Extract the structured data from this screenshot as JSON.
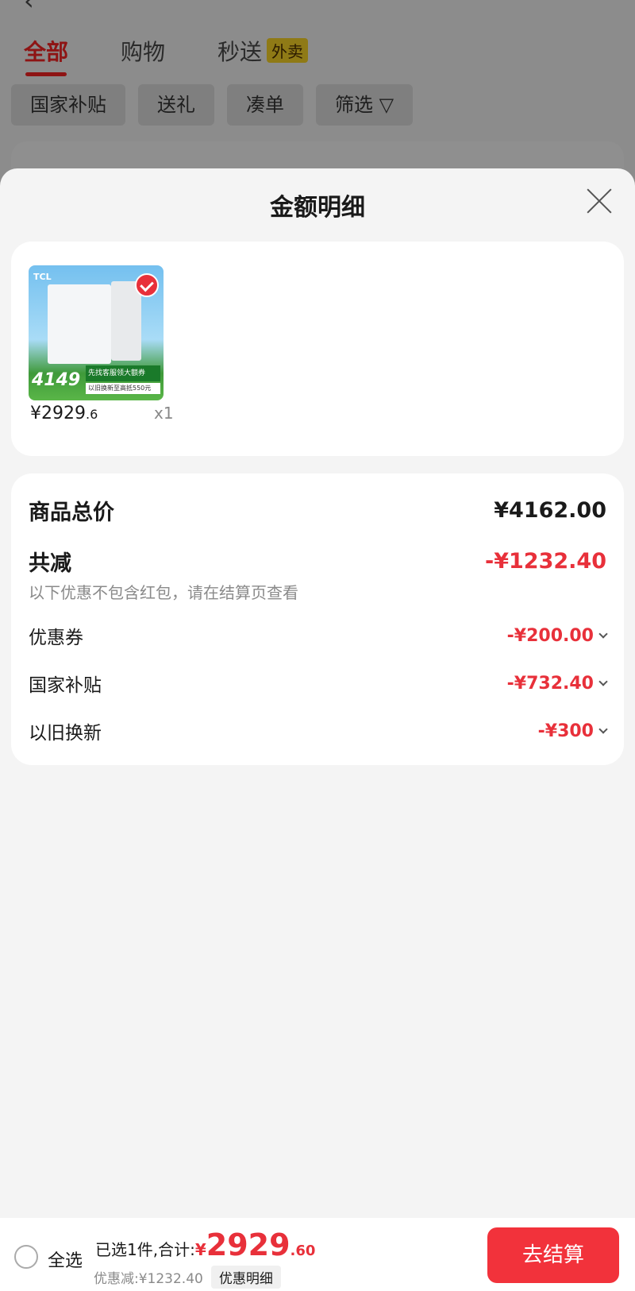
{
  "background": {
    "tabs": [
      {
        "label": "全部",
        "active": true
      },
      {
        "label": "购物",
        "active": false
      },
      {
        "label": "秒送",
        "active": false,
        "badge": "外卖"
      }
    ],
    "chips": [
      "国家补贴",
      "送礼",
      "凑单",
      "筛选 ▽"
    ]
  },
  "sheet": {
    "title": "金额明细",
    "product": {
      "image_brand": "TCL",
      "image_price": "4149",
      "image_banner": "先找客服领大额券",
      "image_banner2": "以旧换新至高抵550元",
      "price_int": "¥2929",
      "price_dec": ".6",
      "quantity": "x1"
    },
    "summary": {
      "total_label": "商品总价",
      "total_value": "¥4162.00",
      "reduce_label": "共减",
      "reduce_value": "-¥1232.40",
      "note": "以下优惠不包含红包，请在结算页查看",
      "items": [
        {
          "label": "优惠券",
          "value": "-¥200.00"
        },
        {
          "label": "国家补贴",
          "value": "-¥732.40"
        },
        {
          "label": "以旧换新",
          "value": "-¥300"
        }
      ]
    }
  },
  "bottom": {
    "select_all": "全选",
    "total_prefix": "已选1件,合计:",
    "yen": "¥",
    "total_int": "2929",
    "total_dec": ".60",
    "saving": "优惠减:¥1232.40",
    "detail_tag": "优惠明细",
    "checkout": "去结算"
  },
  "colors": {
    "accent": "#e8303a",
    "button": "#f2323b"
  }
}
